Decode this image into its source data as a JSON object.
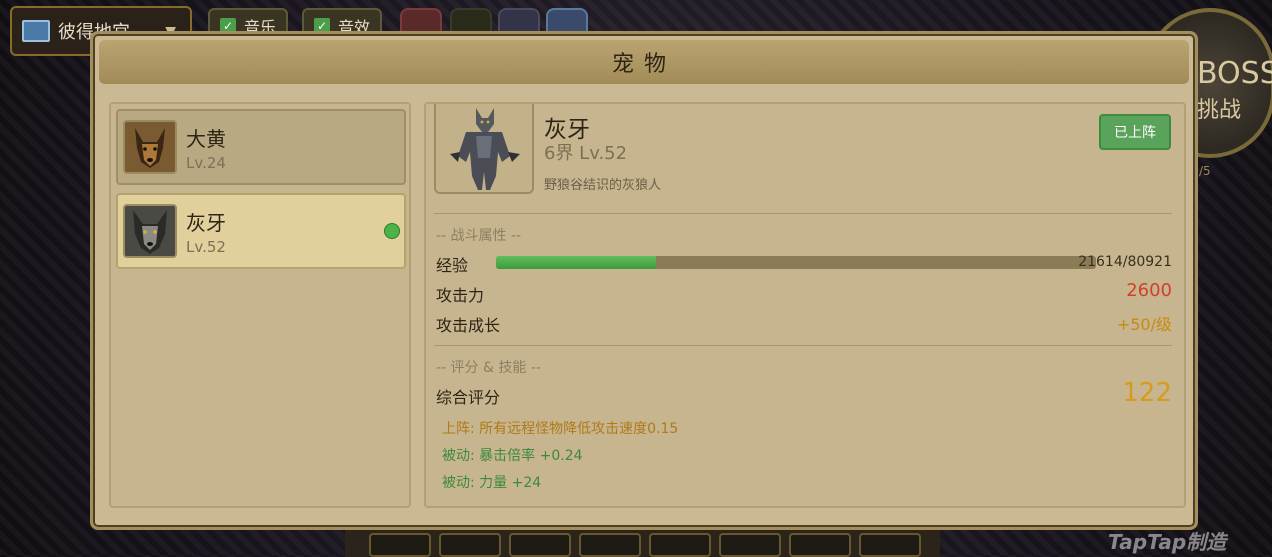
{
  "background": {
    "map_select": {
      "label": "彼得地宫",
      "icon": "map-icon"
    },
    "toggles": [
      {
        "label": "音乐",
        "checked": true
      },
      {
        "label": "音效",
        "checked": true
      }
    ],
    "boss_button": {
      "line1": "BOSS",
      "line2": "挑战",
      "line3": "/5"
    },
    "watermark": "TapTap制造"
  },
  "dialog": {
    "title": "宠物",
    "pets": [
      {
        "name": "大黄",
        "level": "Lv.24",
        "active": false,
        "icon": "dog-portrait"
      },
      {
        "name": "灰牙",
        "level": "Lv.52",
        "active": true,
        "icon": "wolf-portrait"
      }
    ],
    "detail": {
      "name": "灰牙",
      "level": "6界 Lv.52",
      "description": "野狼谷结识的灰狼人",
      "deploy_button": "已上阵",
      "combat_section": "-- 战斗属性 --",
      "exp_label": "经验",
      "exp_text": "21614/80921",
      "exp_current": 21614,
      "exp_max": 80921,
      "attack_label": "攻击力",
      "attack_value": "2600",
      "growth_label": "攻击成长",
      "growth_value": "+50/级",
      "score_section": "-- 评分 & 技能 --",
      "score_label": "综合评分",
      "score_value": "122",
      "skills": [
        {
          "text": "上阵: 所有远程怪物降低攻击速度0.15",
          "color": "#b07a18"
        },
        {
          "text": "被动: 暴击倍率 +0.24",
          "color": "#3e8a3a"
        },
        {
          "text": "被动: 力量 +24",
          "color": "#3e8a3a"
        }
      ]
    },
    "colors": {
      "attack": "#d0402c",
      "growth": "#c88a12",
      "score": "#d89a1a",
      "active_dot": "#4db348"
    }
  }
}
